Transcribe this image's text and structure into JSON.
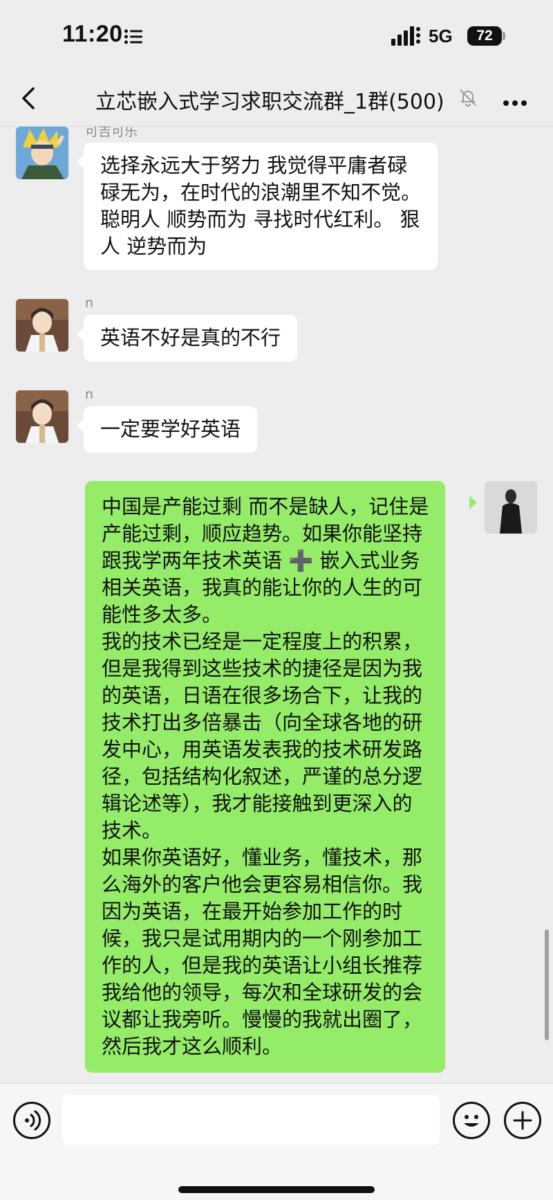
{
  "status_bar": {
    "time": "11:20",
    "network": "5G",
    "battery": "72"
  },
  "nav": {
    "title": "立芯嵌入式学习求职交流群_1群(500)",
    "icons": [
      "back-icon",
      "mute-bell-icon",
      "more-icon"
    ]
  },
  "messages": [
    {
      "sender": "可吉可乐",
      "side": "left",
      "lines": [
        "选择永远大于努力   我觉得平庸者碌",
        "碌无为，在时代的浪潮里不知不觉。",
        "聪明人  顺势而为 寻找时代红利。   狠",
        "人 逆势而为"
      ]
    },
    {
      "sender": "n",
      "side": "left",
      "lines": [
        "英语不好是真的不行"
      ]
    },
    {
      "sender": "n",
      "side": "left",
      "lines": [
        "一定要学好英语"
      ]
    },
    {
      "sender": "",
      "side": "right",
      "lines": [
        "中国是产能过剩 而不是缺人，记住是",
        "产能过剩，顺应趋势。如果你能坚持",
        "跟我学两年技术英语 ➕ 嵌入式业务",
        "相关英语，我真的能让你的人生的可",
        "能性多太多。",
        "我的技术已经是一定程度上的积累，",
        "但是我得到这些技术的捷径是因为我",
        "的英语，日语在很多场合下，让我的",
        "技术打出多倍暴击（向全球各地的研",
        "发中心，用英语发表我的技术研发路",
        "径，包括结构化叙述，严谨的总分逻",
        "辑论述等），我才能接触到更深入的",
        "技术。",
        "如果你英语好，懂业务，懂技术，那",
        "么海外的客户他会更容易相信你。我",
        "因为英语，在最开始参加工作的时",
        "候，我只是试用期内的一个刚参加工",
        "作的人，但是我的英语让小组长推荐",
        "我给他的领导，每次和全球研发的会",
        "议都让我旁听。慢慢的我就出圈了，",
        "然后我才这么顺利。"
      ]
    }
  ],
  "input_bar": {
    "placeholder": "",
    "icons": [
      "voice-icon",
      "emoji-icon",
      "plus-icon"
    ]
  },
  "colors": {
    "background": "#ededed",
    "self_bubble": "#95ec69",
    "other_bubble": "#ffffff"
  }
}
